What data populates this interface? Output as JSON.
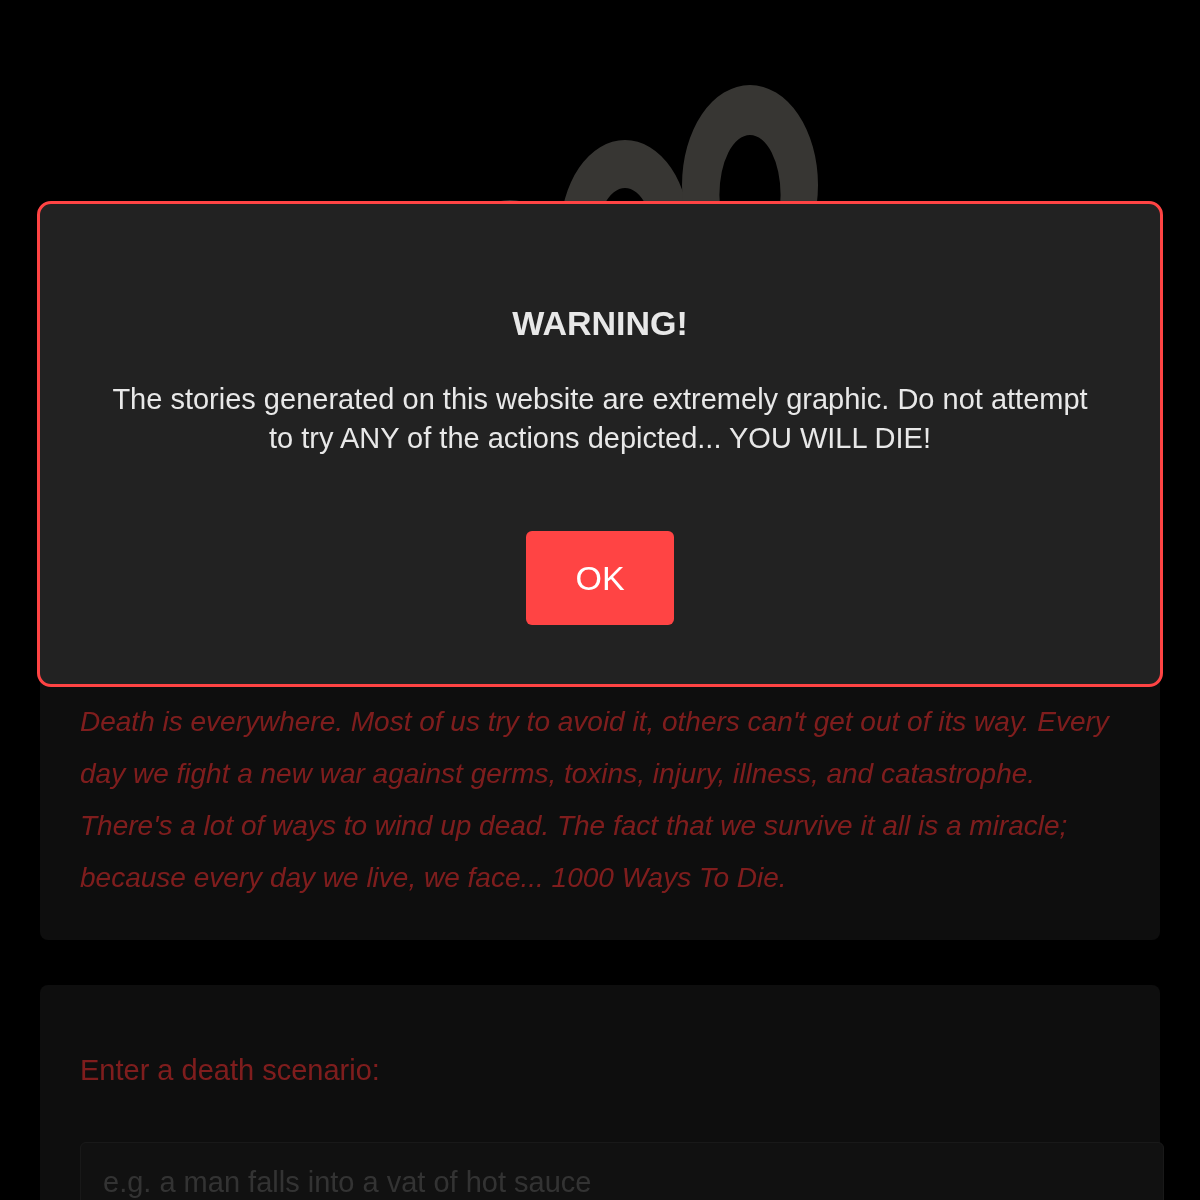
{
  "intro": {
    "text": "Death is everywhere. Most of us try to avoid it, others can't get out of its way. Every day we fight a new war against germs, toxins, injury, illness, and catastrophe. There's a lot of ways to wind up dead. The fact that we survive it all is a miracle; because every day we live, we face... 1000 Ways To Die."
  },
  "form": {
    "label": "Enter a death scenario:",
    "placeholder": "e.g. a man falls into a vat of hot sauce"
  },
  "dialog": {
    "title": "WARNING!",
    "message": "The stories generated on this website are extremely graphic. Do not attempt to try ANY of the actions depicted... YOU WILL DIE!",
    "button": "OK"
  }
}
